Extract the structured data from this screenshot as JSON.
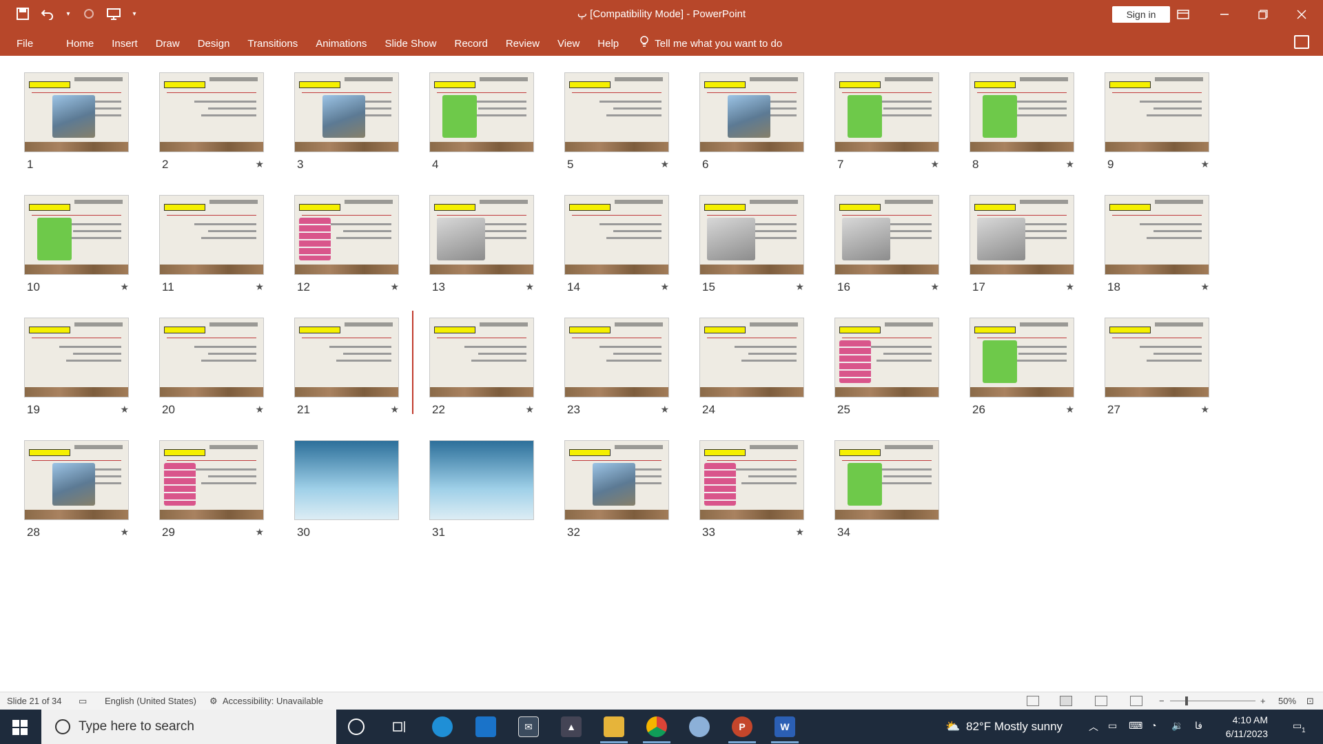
{
  "window": {
    "title": "پ [Compatibility Mode]  -  PowerPoint",
    "signin_label": "Sign in"
  },
  "ribbon": {
    "tabs": [
      "File",
      "Home",
      "Insert",
      "Draw",
      "Design",
      "Transitions",
      "Animations",
      "Slide Show",
      "Record",
      "Review",
      "View",
      "Help"
    ],
    "tell_me": "Tell me what you want to do"
  },
  "slides": [
    {
      "num": "1",
      "star": ""
    },
    {
      "num": "2",
      "star": "★"
    },
    {
      "num": "3",
      "star": ""
    },
    {
      "num": "4",
      "star": ""
    },
    {
      "num": "5",
      "star": "★"
    },
    {
      "num": "6",
      "star": ""
    },
    {
      "num": "7",
      "star": "★"
    },
    {
      "num": "8",
      "star": "★"
    },
    {
      "num": "9",
      "star": "★"
    },
    {
      "num": "10",
      "star": "★"
    },
    {
      "num": "11",
      "star": "★"
    },
    {
      "num": "12",
      "star": "★"
    },
    {
      "num": "13",
      "star": "★"
    },
    {
      "num": "14",
      "star": "★"
    },
    {
      "num": "15",
      "star": "★"
    },
    {
      "num": "16",
      "star": "★"
    },
    {
      "num": "17",
      "star": "★"
    },
    {
      "num": "18",
      "star": "★"
    },
    {
      "num": "19",
      "star": "★"
    },
    {
      "num": "20",
      "star": "★"
    },
    {
      "num": "21",
      "star": "★"
    },
    {
      "num": "22",
      "star": "★"
    },
    {
      "num": "23",
      "star": "★"
    },
    {
      "num": "24",
      "star": ""
    },
    {
      "num": "25",
      "star": ""
    },
    {
      "num": "26",
      "star": "★"
    },
    {
      "num": "27",
      "star": "★"
    },
    {
      "num": "28",
      "star": "★"
    },
    {
      "num": "29",
      "star": "★"
    },
    {
      "num": "30",
      "star": ""
    },
    {
      "num": "31",
      "star": ""
    },
    {
      "num": "32",
      "star": ""
    },
    {
      "num": "33",
      "star": "★"
    },
    {
      "num": "34",
      "star": ""
    }
  ],
  "thumb_styles": [
    "photo",
    "title",
    "photo",
    "green",
    "table",
    "photo",
    "green",
    "green",
    "text",
    "green",
    "text",
    "pinks",
    "gray",
    "text",
    "gray",
    "gray",
    "gray",
    "text",
    "text",
    "text",
    "text",
    "text",
    "text",
    "text",
    "pinks",
    "green",
    "text",
    "photo",
    "pinks",
    "ocean",
    "ocean",
    "photo",
    "pinks",
    "green"
  ],
  "status": {
    "slide_info": "Slide 21 of 34",
    "language": "English (United States)",
    "accessibility": "Accessibility: Unavailable",
    "zoom": "50%"
  },
  "taskbar": {
    "search_placeholder": "Type here to search",
    "weather": "82°F  Mostly sunny",
    "ime": "فا",
    "time": "4:10 AM",
    "date": "6/11/2023",
    "notification_count": "1"
  },
  "colors": {
    "accent": "#b7472a",
    "taskbar": "#1e2b3c",
    "highlight_yellow": "#f5f000",
    "insert_marker": "#c0392b"
  }
}
